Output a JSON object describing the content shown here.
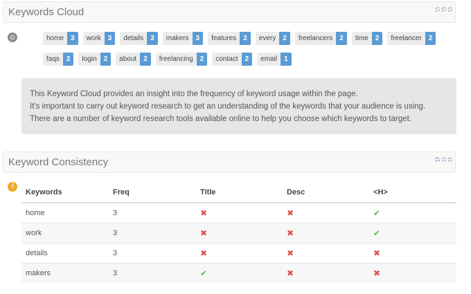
{
  "cloud": {
    "title": "Keywords Cloud",
    "rows": [
      [
        {
          "word": "home",
          "count": "3"
        },
        {
          "word": "work",
          "count": "3"
        },
        {
          "word": "details",
          "count": "3"
        },
        {
          "word": "makers",
          "count": "3"
        },
        {
          "word": "features",
          "count": "2"
        },
        {
          "word": "every",
          "count": "2"
        },
        {
          "word": "freelancers",
          "count": "2"
        },
        {
          "word": "time",
          "count": "2"
        },
        {
          "word": "freelancer",
          "count": "2"
        }
      ],
      [
        {
          "word": "faqs",
          "count": "2"
        },
        {
          "word": "login",
          "count": "2"
        },
        {
          "word": "about",
          "count": "2"
        },
        {
          "word": "freelancing",
          "count": "2"
        },
        {
          "word": "contact",
          "count": "2"
        },
        {
          "word": "email",
          "count": "1"
        }
      ]
    ],
    "info_line1": "This Keyword Cloud provides an insight into the frequency of keyword usage within the page.",
    "info_line2": "It's important to carry out keyword research to get an understanding of the keywords that your audience is using. There are a number of keyword research tools available online to help you choose which keywords to target."
  },
  "consistency": {
    "title": "Keyword Consistency",
    "warn_glyph": "!",
    "headers": [
      "Keywords",
      "Freq",
      "Title",
      "Desc",
      "<H>"
    ],
    "rows": [
      {
        "keyword": "home",
        "freq": "3",
        "title": "no",
        "desc": "no",
        "h": "yes"
      },
      {
        "keyword": "work",
        "freq": "3",
        "title": "no",
        "desc": "no",
        "h": "yes"
      },
      {
        "keyword": "details",
        "freq": "3",
        "title": "no",
        "desc": "no",
        "h": "no"
      },
      {
        "keyword": "makers",
        "freq": "3",
        "title": "yes",
        "desc": "no",
        "h": "no"
      }
    ],
    "yes_glyph": "✔",
    "no_glyph": "✖"
  },
  "colors": {
    "accent": "#5b9bd5",
    "yes": "#5cb85c",
    "no": "#d9534f",
    "warning": "#f0a828"
  }
}
